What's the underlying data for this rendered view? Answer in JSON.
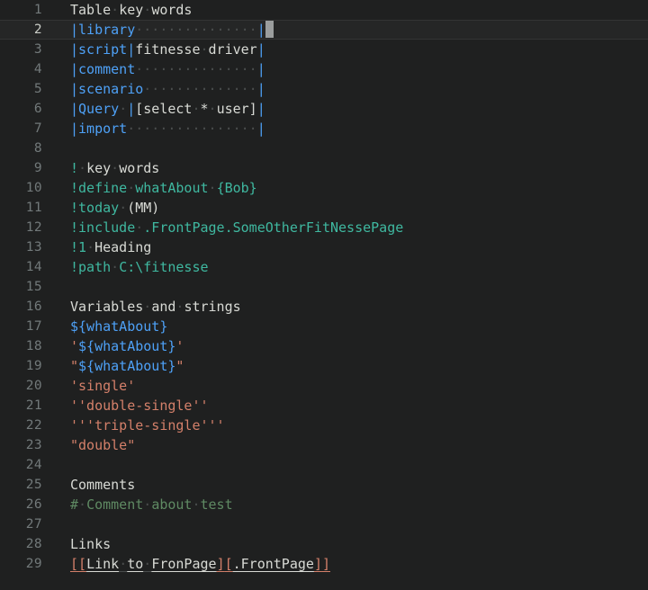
{
  "editor": {
    "name": "code-editor",
    "language": "FitNesse wiki",
    "theme": "dark",
    "colors": {
      "background": "#1f2020",
      "active_line": "#252626",
      "gutter_text": "#72797a",
      "gutter_active_text": "#c9ccc6",
      "plain_text": "#d8dad5",
      "keyword_blue": "#4ea1f7",
      "directive_teal": "#3fb8a0",
      "string_orange": "#d4806a",
      "comment_green": "#5f8a63",
      "whitespace_dot": "#4a4d4d",
      "cursor": "#9a9d9d"
    },
    "cursor": {
      "line": 2,
      "column": 23
    },
    "active_line": 2,
    "first_line_number": 1,
    "last_line_number": 29,
    "whitespace_dot_glyph": "·",
    "lines": [
      {
        "number": "1",
        "tokens": [
          {
            "text": "Table",
            "style": "plain"
          },
          {
            "text": "·",
            "style": "ws"
          },
          {
            "text": "key",
            "style": "plain"
          },
          {
            "text": "·",
            "style": "ws"
          },
          {
            "text": "words",
            "style": "plain"
          }
        ]
      },
      {
        "number": "2",
        "active": true,
        "tokens": [
          {
            "text": "|",
            "style": "kw"
          },
          {
            "text": "library",
            "style": "kw"
          },
          {
            "text": "···············",
            "style": "ws"
          },
          {
            "text": "|",
            "style": "kw"
          }
        ],
        "cursor_after": true
      },
      {
        "number": "3",
        "tokens": [
          {
            "text": "|",
            "style": "kw"
          },
          {
            "text": "script",
            "style": "kw"
          },
          {
            "text": "|",
            "style": "kw"
          },
          {
            "text": "fitnesse",
            "style": "plain"
          },
          {
            "text": "·",
            "style": "ws"
          },
          {
            "text": "driver",
            "style": "plain"
          },
          {
            "text": "|",
            "style": "kw"
          }
        ]
      },
      {
        "number": "4",
        "tokens": [
          {
            "text": "|",
            "style": "kw"
          },
          {
            "text": "comment",
            "style": "kw"
          },
          {
            "text": "···············",
            "style": "ws"
          },
          {
            "text": "|",
            "style": "kw"
          }
        ]
      },
      {
        "number": "5",
        "tokens": [
          {
            "text": "|",
            "style": "kw"
          },
          {
            "text": "scenario",
            "style": "kw"
          },
          {
            "text": "··············",
            "style": "ws"
          },
          {
            "text": "|",
            "style": "kw"
          }
        ]
      },
      {
        "number": "6",
        "tokens": [
          {
            "text": "|",
            "style": "kw"
          },
          {
            "text": "Query",
            "style": "kw"
          },
          {
            "text": "·",
            "style": "ws"
          },
          {
            "text": "|",
            "style": "kw"
          },
          {
            "text": "[select",
            "style": "plain"
          },
          {
            "text": "·",
            "style": "ws"
          },
          {
            "text": "*",
            "style": "plain"
          },
          {
            "text": "·",
            "style": "ws"
          },
          {
            "text": "user]",
            "style": "plain"
          },
          {
            "text": "|",
            "style": "kw"
          }
        ]
      },
      {
        "number": "7",
        "tokens": [
          {
            "text": "|",
            "style": "kw"
          },
          {
            "text": "import",
            "style": "kw"
          },
          {
            "text": "················",
            "style": "ws"
          },
          {
            "text": "|",
            "style": "kw"
          }
        ]
      },
      {
        "number": "8",
        "tokens": []
      },
      {
        "number": "9",
        "tokens": [
          {
            "text": "!",
            "style": "teal"
          },
          {
            "text": "·",
            "style": "ws"
          },
          {
            "text": "key",
            "style": "plain"
          },
          {
            "text": "·",
            "style": "ws"
          },
          {
            "text": "words",
            "style": "plain"
          }
        ]
      },
      {
        "number": "10",
        "tokens": [
          {
            "text": "!define",
            "style": "teal"
          },
          {
            "text": "·",
            "style": "ws"
          },
          {
            "text": "whatAbout",
            "style": "teal"
          },
          {
            "text": "·",
            "style": "ws"
          },
          {
            "text": "{Bob}",
            "style": "teal"
          }
        ]
      },
      {
        "number": "11",
        "tokens": [
          {
            "text": "!today",
            "style": "teal"
          },
          {
            "text": "·",
            "style": "ws"
          },
          {
            "text": "(MM)",
            "style": "plain"
          }
        ]
      },
      {
        "number": "12",
        "tokens": [
          {
            "text": "!include",
            "style": "teal"
          },
          {
            "text": "·",
            "style": "ws"
          },
          {
            "text": ".FrontPage.SomeOtherFitNessePage",
            "style": "teal"
          }
        ]
      },
      {
        "number": "13",
        "tokens": [
          {
            "text": "!1",
            "style": "teal"
          },
          {
            "text": "·",
            "style": "ws"
          },
          {
            "text": "Heading",
            "style": "plain"
          }
        ]
      },
      {
        "number": "14",
        "tokens": [
          {
            "text": "!path",
            "style": "teal"
          },
          {
            "text": "·",
            "style": "ws"
          },
          {
            "text": "C:\\fitnesse",
            "style": "teal"
          }
        ]
      },
      {
        "number": "15",
        "tokens": []
      },
      {
        "number": "16",
        "tokens": [
          {
            "text": "Variables",
            "style": "plain"
          },
          {
            "text": "·",
            "style": "ws"
          },
          {
            "text": "and",
            "style": "plain"
          },
          {
            "text": "·",
            "style": "ws"
          },
          {
            "text": "strings",
            "style": "plain"
          }
        ]
      },
      {
        "number": "17",
        "tokens": [
          {
            "text": "${whatAbout}",
            "style": "kw"
          }
        ]
      },
      {
        "number": "18",
        "tokens": [
          {
            "text": "'",
            "style": "str"
          },
          {
            "text": "${whatAbout}",
            "style": "kw"
          },
          {
            "text": "'",
            "style": "str"
          }
        ]
      },
      {
        "number": "19",
        "tokens": [
          {
            "text": "\"",
            "style": "str"
          },
          {
            "text": "${whatAbout}",
            "style": "kw"
          },
          {
            "text": "\"",
            "style": "str"
          }
        ]
      },
      {
        "number": "20",
        "tokens": [
          {
            "text": "'single'",
            "style": "str"
          }
        ]
      },
      {
        "number": "21",
        "tokens": [
          {
            "text": "''double-single''",
            "style": "str"
          }
        ]
      },
      {
        "number": "22",
        "tokens": [
          {
            "text": "'''triple-single'''",
            "style": "str"
          }
        ]
      },
      {
        "number": "23",
        "tokens": [
          {
            "text": "\"double\"",
            "style": "str"
          }
        ]
      },
      {
        "number": "24",
        "tokens": []
      },
      {
        "number": "25",
        "tokens": [
          {
            "text": "Comments",
            "style": "plain"
          }
        ]
      },
      {
        "number": "26",
        "tokens": [
          {
            "text": "#",
            "style": "comment"
          },
          {
            "text": "·",
            "style": "ws"
          },
          {
            "text": "Comment",
            "style": "comment"
          },
          {
            "text": "·",
            "style": "ws"
          },
          {
            "text": "about",
            "style": "comment"
          },
          {
            "text": "·",
            "style": "ws"
          },
          {
            "text": "test",
            "style": "comment"
          }
        ]
      },
      {
        "number": "27",
        "tokens": []
      },
      {
        "number": "28",
        "tokens": [
          {
            "text": "Links",
            "style": "plain"
          }
        ]
      },
      {
        "number": "29",
        "tokens": [
          {
            "text": "[[",
            "style": "bracket",
            "underline": true
          },
          {
            "text": "Link",
            "style": "link",
            "underline": true
          },
          {
            "text": "·",
            "style": "ws",
            "underline": true
          },
          {
            "text": "to",
            "style": "link",
            "underline": true
          },
          {
            "text": "·",
            "style": "ws",
            "underline": true
          },
          {
            "text": "FronPage",
            "style": "link",
            "underline": true
          },
          {
            "text": "]",
            "style": "bracket",
            "underline": true
          },
          {
            "text": "[",
            "style": "bracket",
            "underline": true
          },
          {
            "text": ".FrontPage",
            "style": "link",
            "underline": true
          },
          {
            "text": "]",
            "style": "bracket",
            "underline": true
          },
          {
            "text": "]",
            "style": "bracket",
            "underline": true
          }
        ]
      }
    ]
  }
}
